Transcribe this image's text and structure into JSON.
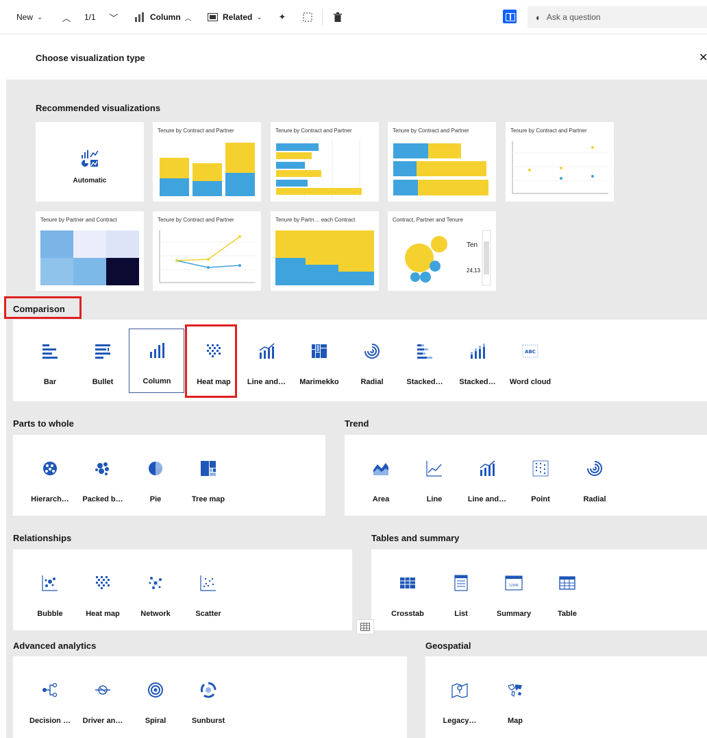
{
  "toolbar": {
    "new_label": "New",
    "page_counter": "1/1",
    "column_label": "Column",
    "related_label": "Related",
    "ask_placeholder": "Ask a question"
  },
  "dialog": {
    "title": "Choose visualization type"
  },
  "recommended": {
    "title": "Recommended visualizations",
    "cards": [
      {
        "caption": "",
        "label": "Automatic"
      },
      {
        "caption": "Tenure by Contract and Partner"
      },
      {
        "caption": "Tenure by Contract and Partner"
      },
      {
        "caption": "Tenure by Contract and Partner"
      },
      {
        "caption": "Tenure by Contract and Partner"
      },
      {
        "caption": "Tenure by Partner and Contract"
      },
      {
        "caption": "Tenure by Contract and Partner"
      },
      {
        "caption": "Tenure by Partn… each Contract"
      },
      {
        "caption": "Contract, Partner and Tenure",
        "mini_text_1": "Ten",
        "mini_text_2": "24,13"
      }
    ]
  },
  "comparison": {
    "title": "Comparison",
    "items": [
      "Bar",
      "Bullet",
      "Column",
      "Heat map",
      "Line and…",
      "Marimekko",
      "Radial",
      "Stacked…",
      "Stacked…",
      "Word cloud"
    ],
    "selected": "Column",
    "highlighted": "Heat map"
  },
  "parts_to_whole": {
    "title": "Parts to whole",
    "items": [
      "Hierarch…",
      "Packed b…",
      "Pie",
      "Tree map"
    ]
  },
  "trend": {
    "title": "Trend",
    "items": [
      "Area",
      "Line",
      "Line and…",
      "Point",
      "Radial"
    ]
  },
  "relationships": {
    "title": "Relationships",
    "items": [
      "Bubble",
      "Heat map",
      "Network",
      "Scatter"
    ]
  },
  "tables": {
    "title": "Tables and summary",
    "items": [
      "Crosstab",
      "List",
      "Summary",
      "Table"
    ],
    "summary_icon_text": "12345"
  },
  "advanced": {
    "title": "Advanced analytics",
    "items": [
      "Decision …",
      "Driver an…",
      "Spiral",
      "Sunburst"
    ]
  },
  "geospatial": {
    "title": "Geospatial",
    "items": [
      "Legacy…",
      "Map"
    ]
  },
  "colors": {
    "accent": "#0f62fe",
    "icon_blue": "#1f57b8",
    "chart_yellow": "#f5d130",
    "chart_blue": "#3fa3dd",
    "highlight_red": "#e02020",
    "backdrop": "#e9e9e9"
  }
}
